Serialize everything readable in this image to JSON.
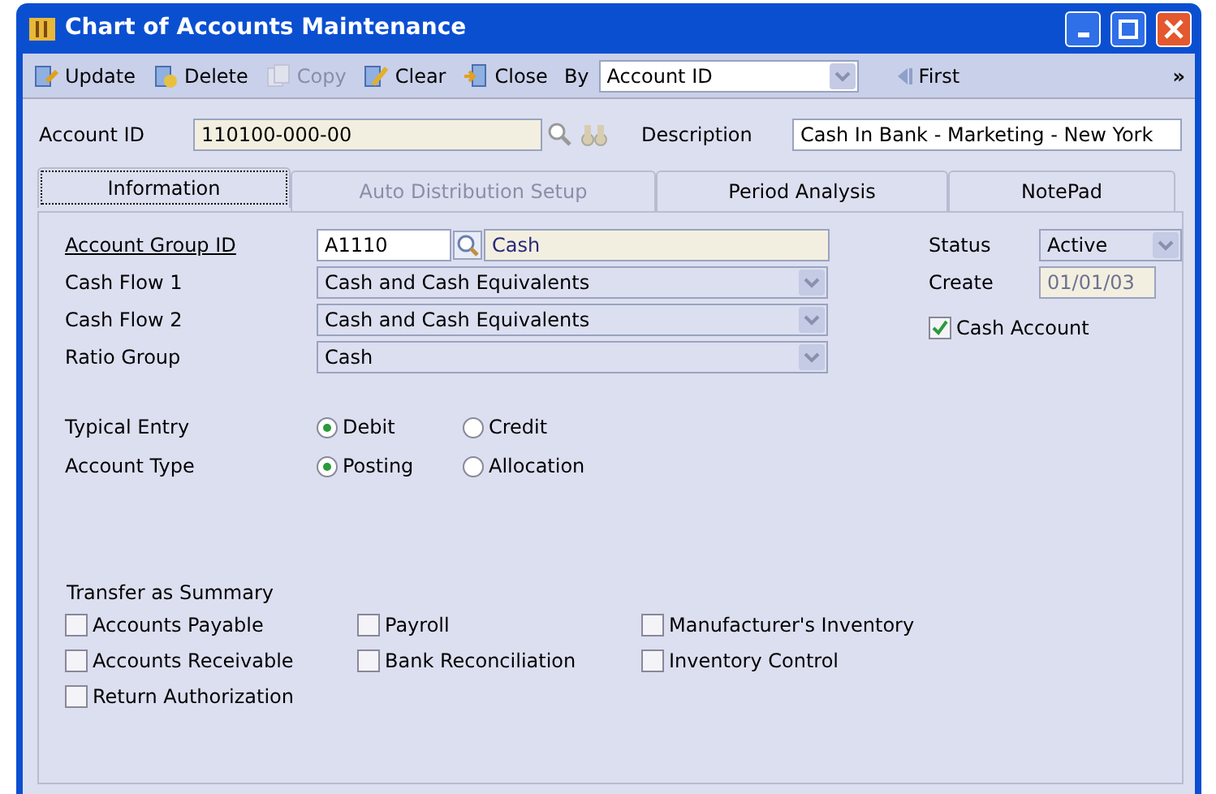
{
  "window": {
    "title": "Chart of Accounts Maintenance"
  },
  "toolbar": {
    "buttons": [
      {
        "label": "Update",
        "disabled": false
      },
      {
        "label": "Delete",
        "disabled": false
      },
      {
        "label": "Copy",
        "disabled": true
      },
      {
        "label": "Clear",
        "disabled": false
      },
      {
        "label": "Close",
        "disabled": false
      }
    ],
    "by_label": "By",
    "by_value": "Account ID",
    "first_label": "First",
    "more": "»"
  },
  "header": {
    "account_label": "Account ID",
    "account_value": "110100-000-00",
    "description_label": "Description",
    "description_value": "Cash In Bank - Marketing - New York"
  },
  "tabs": [
    {
      "label": "Information",
      "selected": true,
      "disabled": false
    },
    {
      "label": "Auto Distribution Setup",
      "selected": false,
      "disabled": true
    },
    {
      "label": "Period Analysis",
      "selected": false,
      "disabled": false
    },
    {
      "label": "NotePad",
      "selected": false,
      "disabled": false
    }
  ],
  "account_group": {
    "label": "Account Group ID",
    "value": "A1110",
    "name": "Cash"
  },
  "selects": [
    {
      "label": "Cash Flow 1",
      "value": "Cash and Cash Equivalents"
    },
    {
      "label": "Cash Flow 2",
      "value": "Cash and Cash Equivalents"
    },
    {
      "label": "Ratio Group",
      "value": "Cash"
    }
  ],
  "status": {
    "label": "Status",
    "value": "Active"
  },
  "create": {
    "label": "Create",
    "value": "01/01/03",
    "disabled": true
  },
  "cash_account": {
    "label": "Cash Account",
    "checked": true
  },
  "radio_groups": [
    {
      "label": "Typical Entry",
      "options": [
        {
          "label": "Debit",
          "selected": true
        },
        {
          "label": "Credit",
          "selected": false
        }
      ]
    },
    {
      "label": "Account Type",
      "options": [
        {
          "label": "Posting",
          "selected": true
        },
        {
          "label": "Allocation",
          "selected": false
        }
      ]
    }
  ],
  "transfer": {
    "title": "Transfer as Summary",
    "items": [
      {
        "label": "Accounts Payable",
        "checked": false
      },
      {
        "label": "Payroll",
        "checked": false
      },
      {
        "label": "Manufacturer's Inventory",
        "checked": false
      },
      {
        "label": "Accounts Receivable",
        "checked": false
      },
      {
        "label": "Bank Reconciliation",
        "checked": false
      },
      {
        "label": "Inventory Control",
        "checked": false
      },
      {
        "label": "Return Authorization",
        "checked": false
      }
    ]
  }
}
